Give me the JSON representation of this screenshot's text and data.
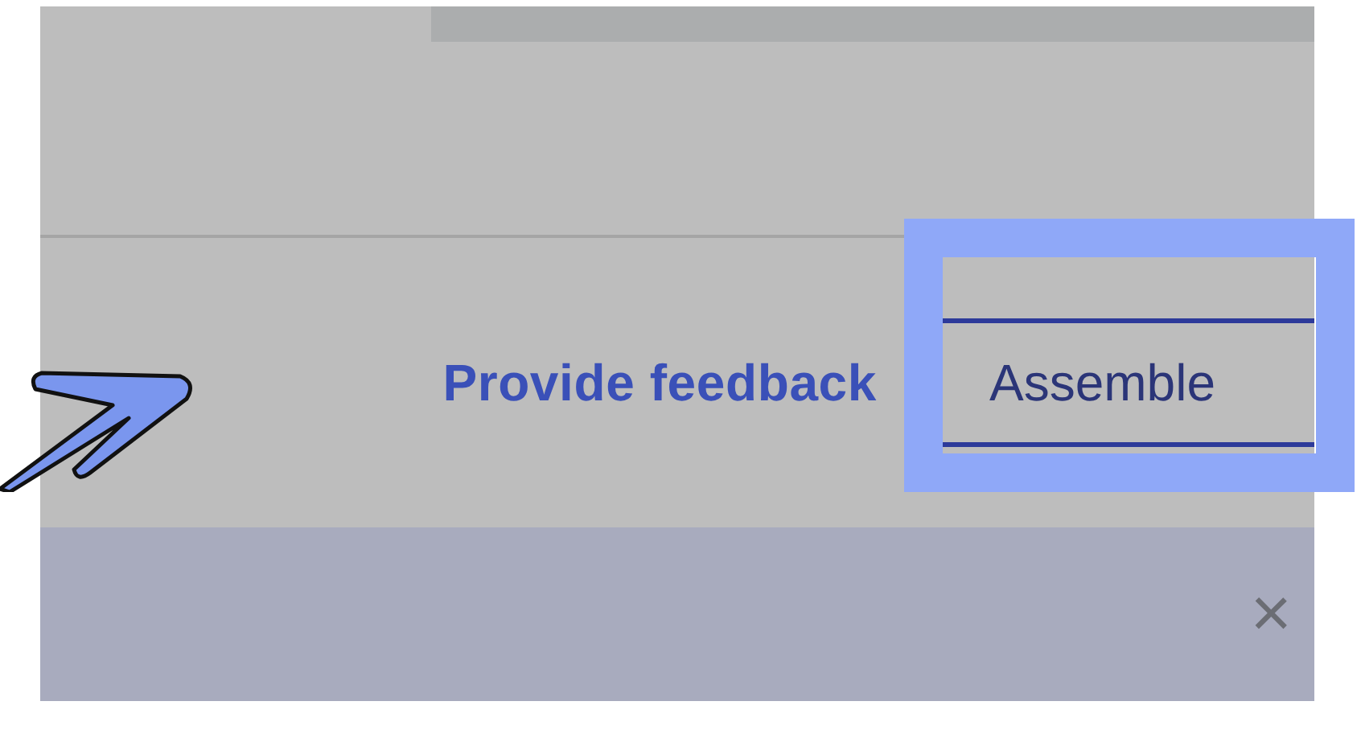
{
  "footer": {
    "feedback_link": "Provide feedback",
    "assemble_button": "Assemble"
  },
  "banner": {
    "close": "×"
  }
}
